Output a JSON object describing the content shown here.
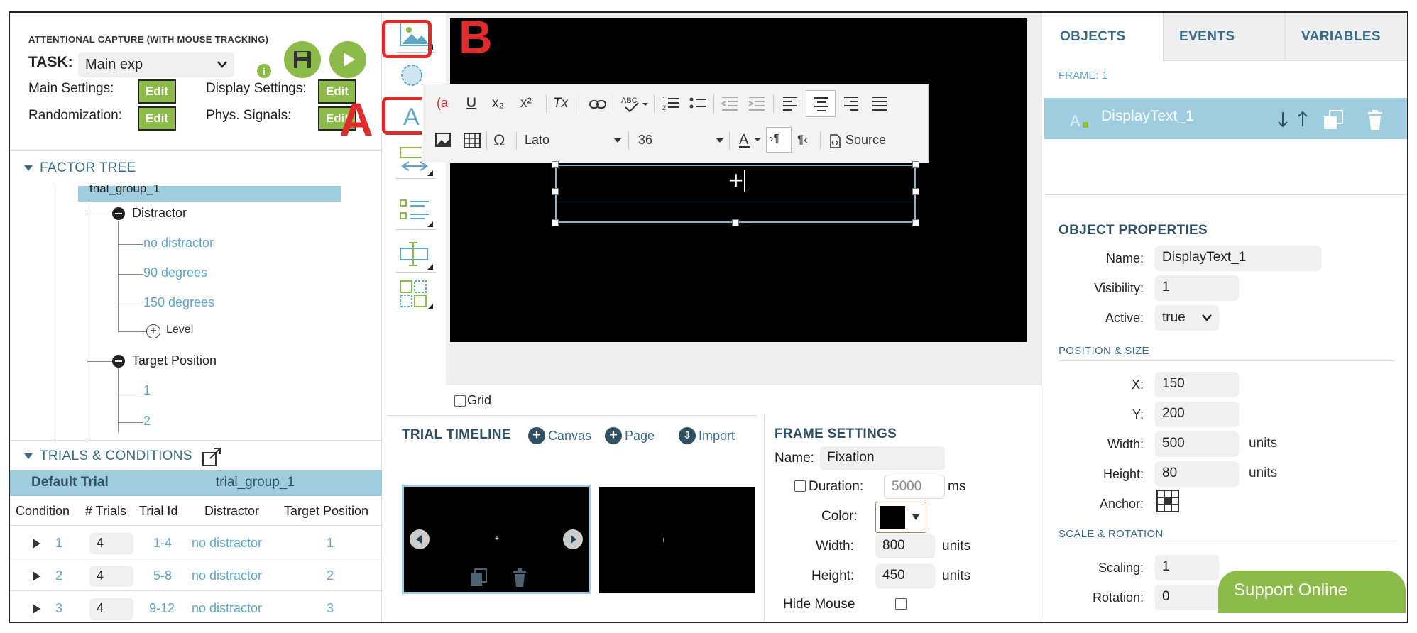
{
  "header": {
    "task_title": "ATTENTIONAL CAPTURE (WITH MOUSE TRACKING)",
    "task_label": "TASK:",
    "task_value": "Main exp",
    "info_glyph": "i"
  },
  "settings": {
    "main_label": "Main Settings:",
    "display_label": "Display Settings:",
    "randomization_label": "Randomization:",
    "phys_label": "Phys. Signals:",
    "edit_label": "Edit"
  },
  "factor_tree": {
    "heading": "FACTOR TREE",
    "group": "trial_group_1",
    "factors": [
      {
        "name": "Distractor",
        "levels": [
          "no distractor",
          "90 degrees",
          "150 degrees"
        ],
        "add_level": "Level"
      },
      {
        "name": "Target Position",
        "levels": [
          "1",
          "2"
        ]
      }
    ]
  },
  "trials": {
    "heading": "TRIALS & CONDITIONS",
    "default_trial": "Default Trial",
    "group": "trial_group_1",
    "columns": [
      "Condition",
      "# Trials",
      "Trial Id",
      "Distractor",
      "Target Position"
    ],
    "rows": [
      {
        "condition": "1",
        "trials": "4",
        "trial_id": "1-4",
        "distractor": "no distractor",
        "target": "1"
      },
      {
        "condition": "2",
        "trials": "4",
        "trial_id": "5-8",
        "distractor": "no distractor",
        "target": "2"
      },
      {
        "condition": "3",
        "trials": "4",
        "trial_id": "9-12",
        "distractor": "no distractor",
        "target": "3"
      }
    ]
  },
  "annotations": {
    "a": "A",
    "b": "B"
  },
  "editor": {
    "font": "Lato",
    "size": "36",
    "source": "Source",
    "omega": "Ω",
    "underline": "U",
    "subscript": "x₂",
    "superscript": "x²",
    "clear_format": "Tx",
    "textbox_content": "+"
  },
  "canvas": {
    "grid_label": "Grid"
  },
  "timeline": {
    "heading": "TRIAL TIMELINE",
    "canvas_label": "Canvas",
    "page_label": "Page",
    "import_label": "Import"
  },
  "frame_settings": {
    "heading": "FRAME SETTINGS",
    "name_label": "Name:",
    "name_value": "Fixation",
    "duration_label": "Duration:",
    "duration_value": "5000",
    "duration_unit": "ms",
    "color_label": "Color:",
    "color_value": "#000000",
    "width_label": "Width:",
    "width_value": "800",
    "height_label": "Height:",
    "height_value": "450",
    "units": "units",
    "hide_mouse_label": "Hide Mouse"
  },
  "right_panel": {
    "tabs": [
      "OBJECTS",
      "EVENTS",
      "VARIABLES"
    ],
    "frame_label": "FRAME: 1",
    "object_name": "DisplayText_1",
    "props_heading": "OBJECT PROPERTIES",
    "name_label": "Name:",
    "name_value": "DisplayText_1",
    "visibility_label": "Visibility:",
    "visibility_value": "1",
    "active_label": "Active:",
    "active_value": "true",
    "pos_heading": "POSITION & SIZE",
    "x_label": "X:",
    "x_value": "150",
    "y_label": "Y:",
    "y_value": "200",
    "width_label": "Width:",
    "width_value": "500",
    "height_label": "Height:",
    "height_value": "80",
    "units": "units",
    "anchor_label": "Anchor:",
    "scale_heading": "SCALE & ROTATION",
    "scaling_label": "Scaling:",
    "scaling_value": "1",
    "rotation_label": "Rotation:",
    "rotation_value": "0"
  },
  "support": {
    "label": "Support Online"
  },
  "colors": {
    "accent_green": "#8dbb4a",
    "accent_blue": "#9fcde0",
    "annotation_red": "#e02b2b"
  }
}
